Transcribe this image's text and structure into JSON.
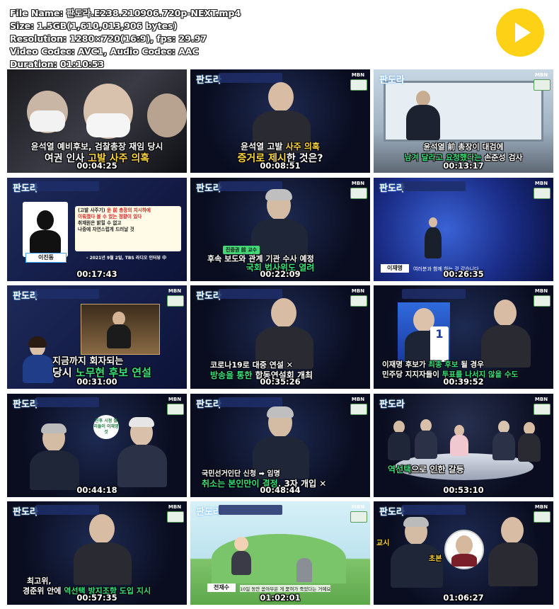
{
  "header": {
    "file_name_line": "File Name: 판도라.E238.210906.720p-NEXT.mp4",
    "size_line": "Size: 1.5GB(1,610,013,906 bytes)",
    "resolution_line": "Resolution: 1280×720(16:9), fps: 29.97",
    "codec_line": "Video Codec: AVC1, Audio Codec: AAC",
    "duration_line": "Duration: 01:10:53"
  },
  "play_button": {
    "icon": "play-icon",
    "color": "#fcd116"
  },
  "channel": {
    "logo": "판도라",
    "network": "MBN"
  },
  "thumbnails": [
    {
      "timestamp": "00:04:25",
      "caption_line1": "윤석열 예비후보, 검찰총장 재임 당시",
      "caption_line2_pre": "여권 인사 ",
      "caption_line2_hl": "고발 사주 의혹",
      "caption_line2_post": ""
    },
    {
      "timestamp": "00:08:51",
      "caption_line1_pre": "윤석열 고발 ",
      "caption_line1_hl": "사주 의혹",
      "caption_line1_post": "",
      "caption_line2_hl": "증거로 제시",
      "caption_line2_post": "한 것은?"
    },
    {
      "timestamp": "00:13:17",
      "caption_line1": "윤석열 前 총장이 대검에",
      "caption_line2_hl": "남겨 달라고 요청했다는",
      "caption_line2_post": " 손준성 검사"
    },
    {
      "timestamp": "00:17:43",
      "quote_line1": "(고발 사주기)",
      "quote_line1b": "윤 前 총장의 지시하에",
      "quote_line2": "이뤄졌다 볼 수 있는 정황이 있다",
      "quote_line3": "취재원은 밝힐 수 없고",
      "quote_line4": "나중에 자연스럽게 드러날 것",
      "quote_source": "- 2021년 9월 2일, TBS 라디오 인터뷰 中",
      "name_label": "이진동"
    },
    {
      "timestamp": "00:22:09",
      "tag": "진중권 前 교수",
      "caption_line1": "후속 보도와 관계 기관 수사 예정",
      "caption_line2_hl": "국회 법사위도 열려"
    },
    {
      "timestamp": "00:26:35",
      "name_label": "이재명",
      "sub_caption": "여러분과 함께 하는 것 같습니다"
    },
    {
      "timestamp": "00:31:00",
      "caption_line1": "지금까지 회자되는",
      "caption_line2_pre": "당시 ",
      "caption_line2_hl": "노무현 후보 연설"
    },
    {
      "timestamp": "00:35:26",
      "caption_line1": "코로나19로 대중 연설 ✕",
      "caption_line2_pre": "방송을 통한 ",
      "caption_line2_hl": "합동연설회",
      "caption_line2_post": " 개최"
    },
    {
      "timestamp": "00:39:52",
      "caption_line1_pre": "이재명 후보가 ",
      "caption_line1_hl": "최종 후보",
      "caption_line1_post": " 될 경우",
      "caption_line2_pre": "민주당 지지자들이 ",
      "caption_line2_hl": "투표를 나서지 않을 수도"
    },
    {
      "timestamp": "00:44:18",
      "side_note": "친후 시점 찰리들이 이재명 것"
    },
    {
      "timestamp": "00:48:44",
      "caption_line1": "국민선거인단 신청 ➡ 임명",
      "caption_line2_hl": "취소는 본인만이 결정",
      "caption_line2_post": ", 3자 개입 ✕"
    },
    {
      "timestamp": "00:53:10",
      "caption_line1_hl": "역선택",
      "caption_line1_post": "으로 인한 갈등"
    },
    {
      "timestamp": "00:57:35",
      "caption_line1": "최고위,",
      "caption_line2_pre": "경준위 안에 ",
      "caption_line2_hl": "역선택 방지조항",
      "caption_line2_post": " 도입 지시"
    },
    {
      "timestamp": "01:02:01",
      "name_label": "전재수",
      "sub_caption": "10일 동안 쏟아부은 게 묻혀가 죽었다는 거예요"
    },
    {
      "timestamp": "01:06:27",
      "side_text1": "교시",
      "side_text2": "초본"
    }
  ]
}
